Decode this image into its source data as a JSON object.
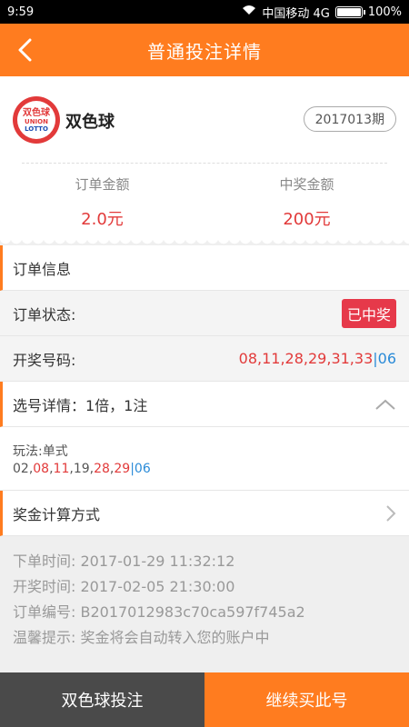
{
  "status_bar": {
    "time": "9:59",
    "carrier": "中国移动 4G",
    "battery": "100%",
    "battery_level": 1.0
  },
  "header": {
    "title": "普通投注详情"
  },
  "lottery": {
    "name": "双色球",
    "issue": "2017013期",
    "logo_text_1": "双色球",
    "logo_text_2": "UNION",
    "logo_text_3": "LOTTO"
  },
  "amounts": {
    "order_label": "订单金额",
    "order_value": "2.0元",
    "prize_label": "中奖金额",
    "prize_value": "200元"
  },
  "order_info": {
    "section_title": "订单信息",
    "status_label": "订单状态:",
    "status_value": "已中奖",
    "draw_label": "开奖号码:",
    "draw_red": "08,11,28,29,31,33",
    "draw_sep": "|",
    "draw_blue": "06"
  },
  "pick_detail": {
    "title": "选号详情：1倍，1注",
    "play": "玩法:单式",
    "picked": [
      {
        "text": "02,",
        "color": "normal"
      },
      {
        "text": "08",
        "color": "red"
      },
      {
        "text": ",",
        "color": "normal"
      },
      {
        "text": "11",
        "color": "red"
      },
      {
        "text": ",19,",
        "color": "normal"
      },
      {
        "text": "28",
        "color": "red"
      },
      {
        "text": ",",
        "color": "normal"
      },
      {
        "text": "29",
        "color": "red"
      },
      {
        "text": "|",
        "color": "blue"
      },
      {
        "text": "06",
        "color": "blue"
      }
    ]
  },
  "prize_calc": {
    "title": "奖金计算方式"
  },
  "meta": {
    "order_time": "下单时间: 2017-01-29 11:32:12",
    "draw_time": "开奖时间: 2017-02-05 21:30:00",
    "order_no": "订单编号: B2017012983c70ca597f745a2",
    "tip": "温馨提示: 奖金将会自动转入您的账户中"
  },
  "actions": {
    "left": "双色球投注",
    "right": "继续买此号"
  },
  "colors": {
    "brand": "#ff7c1f",
    "red": "#e23a3a",
    "blue": "#2a8bd8",
    "dark": "#4a4a4a"
  }
}
